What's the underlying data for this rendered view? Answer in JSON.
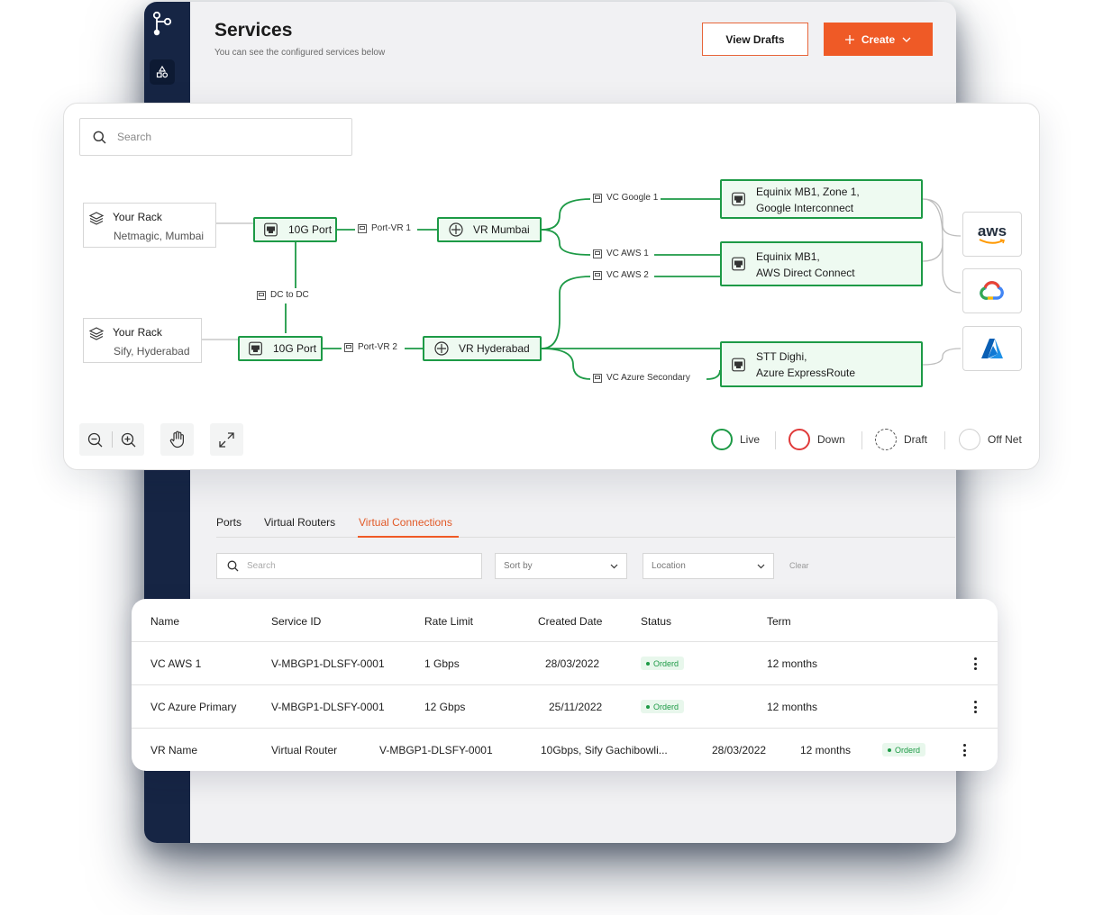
{
  "header": {
    "title": "Services",
    "subtitle": "You can see the configured services below",
    "drafts_label": "View Drafts",
    "create_label": "Create"
  },
  "tabs": [
    "Ports",
    "Virtual Routers",
    "Virtual Connections"
  ],
  "active_tab": "Virtual Connections",
  "filters": {
    "search_placeholder": "Search",
    "sort_label": "Sort by",
    "location_label": "Location",
    "clear_label": "Clear"
  },
  "topology": {
    "search_placeholder": "Search",
    "racks": [
      {
        "title": "Your Rack",
        "subtitle": "Netmagic, Mumbai"
      },
      {
        "title": "Your Rack",
        "subtitle": "Sify, Hyderabad"
      }
    ],
    "ports": [
      "10G Port",
      "10G Port"
    ],
    "routers": [
      "VR Mumbai",
      "VR Hyderabad"
    ],
    "links": {
      "port_vr1": "Port-VR 1",
      "port_vr2": "Port-VR 2",
      "dc_to_dc": "DC to DC",
      "vc_google1": "VC Google 1",
      "vc_aws1": "VC AWS 1",
      "vc_aws2": "VC AWS 2",
      "vc_azure_secondary": "VC Azure Secondary"
    },
    "endpoints": [
      {
        "line1": "Equinix MB1, Zone 1,",
        "line2": "Google Interconnect"
      },
      {
        "line1": "Equinix MB1,",
        "line2": "AWS Direct Connect"
      },
      {
        "line1": "STT Dighi,",
        "line2": "Azure ExpressRoute"
      }
    ],
    "clouds": {
      "aws_text": "aws",
      "providers": [
        "aws-icon",
        "google-cloud-icon",
        "azure-icon"
      ]
    },
    "legend": [
      {
        "label": "Live",
        "color": "#1d9a46",
        "style": "solid"
      },
      {
        "label": "Down",
        "color": "#e03a3a",
        "style": "solid"
      },
      {
        "label": "Draft",
        "color": "#555555",
        "style": "dashed"
      },
      {
        "label": "Off Net",
        "color": "#cfcfcf",
        "style": "solid"
      }
    ],
    "colors": {
      "live": "#1d9a46",
      "accent": "#ef5a26",
      "sidebar": "#162544"
    }
  },
  "table": {
    "columns": [
      "Name",
      "Service ID",
      "Rate Limit",
      "Created Date",
      "Status",
      "Term"
    ],
    "rows": [
      {
        "name": "VC AWS 1",
        "service_id": "V-MBGP1-DLSFY-0001",
        "rate": "1 Gbps",
        "date": "28/03/2022",
        "status": "Orderd",
        "term": "12 months"
      },
      {
        "name": "VC Azure Primary",
        "service_id": "V-MBGP1-DLSFY-0001",
        "rate": "12 Gbps",
        "date": "25/11/2022",
        "status": "Orderd",
        "term": "12 months"
      }
    ],
    "vr_row": {
      "name": "VR Name",
      "type": "Virtual Router",
      "service_id": "V-MBGP1-DLSFY-0001",
      "location": "10Gbps, Sify Gachibowli...",
      "date": "28/03/2022",
      "term": "12 months",
      "status": "Orderd"
    }
  }
}
